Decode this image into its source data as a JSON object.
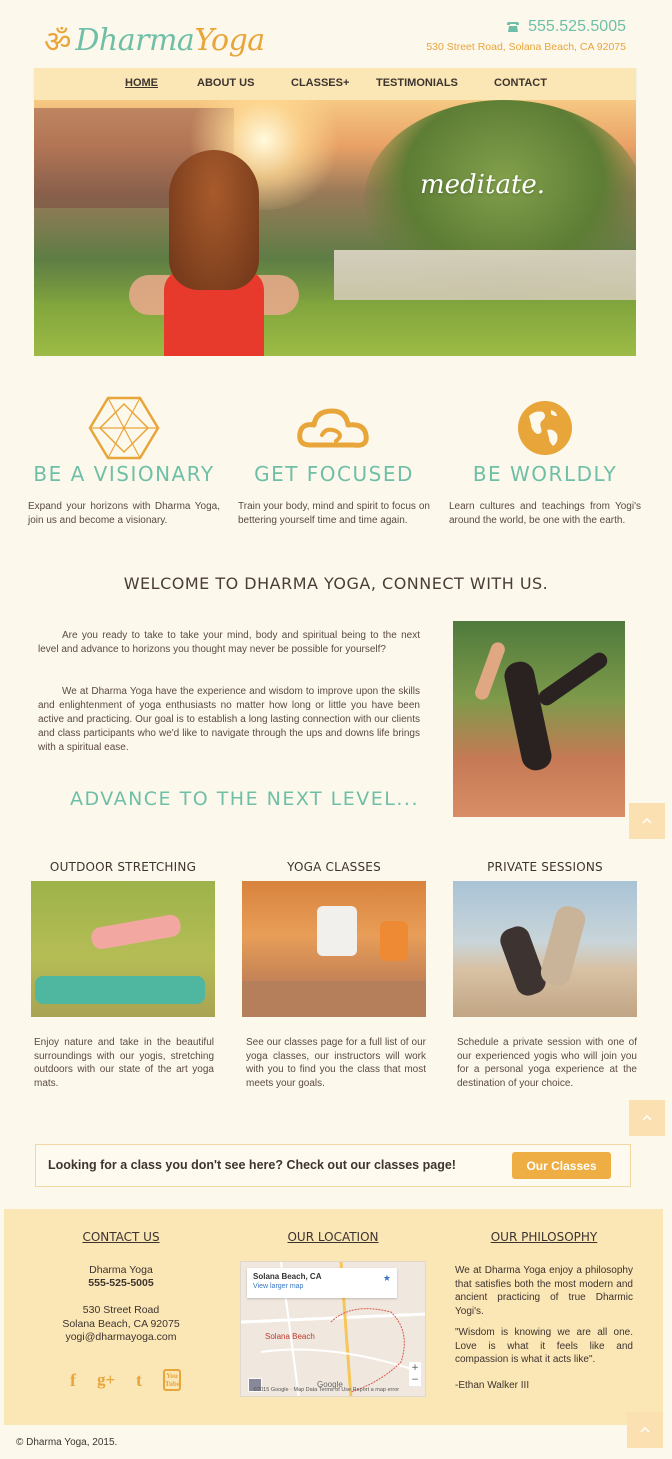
{
  "header": {
    "logo_symbol": "ॐ",
    "logo_word1": "Dharma",
    "logo_word2": "Yoga",
    "phone": "555.525.5005",
    "address": "530 Street Road, Solana Beach, CA 92075"
  },
  "nav": {
    "items": [
      {
        "label": "HOME"
      },
      {
        "label": "ABOUT US"
      },
      {
        "label": "CLASSES"
      },
      {
        "label": "TESTIMONIALS"
      },
      {
        "label": "CONTACT"
      }
    ],
    "classes_expander": "+"
  },
  "hero": {
    "caption": "meditate."
  },
  "features": [
    {
      "title": "BE A VISIONARY",
      "text": "Expand your horizons with Dharma Yoga, join us and become a visionary.",
      "icon": "hexagon-geometric-icon"
    },
    {
      "title": "GET FOCUSED",
      "text": "Train your body, mind and spirit to focus on bettering yourself time and time again.",
      "icon": "cloud-icon"
    },
    {
      "title": "BE WORLDLY",
      "text": "Learn cultures and teachings from Yogi's around the world, be one with the earth.",
      "icon": "globe-icon"
    }
  ],
  "welcome": {
    "title": "WELCOME TO DHARMA YOGA, CONNECT WITH US.",
    "paragraph1": "Are you ready to take to take your mind, body and spiritual being to the next level and advance to horizons you thought may never be possible for yourself?",
    "paragraph2": "We at Dharma Yoga have the experience and wisdom to improve upon the skills and enlightenment of yoga enthusiasts no matter how long or little you have been active and practicing. Our goal is to establish a long lasting connection with our clients and class participants who we'd like to navigate through the ups and downs life brings with a spiritual ease.",
    "advance": "ADVANCE TO THE NEXT LEVEL..."
  },
  "services": [
    {
      "title": "OUTDOOR STRETCHING",
      "text": "Enjoy nature and take in the beautiful surroundings with our yogis, stretching outdoors with our state of the art yoga mats."
    },
    {
      "title": "YOGA CLASSES",
      "text": "See our classes page for a full list of our yoga classes, our instructors will work with you to find you the class that most meets your goals."
    },
    {
      "title": "PRIVATE SESSIONS",
      "text": "Schedule a private session with one of our experienced yogis who will join you for a personal yoga experience at the destination of your choice."
    }
  ],
  "cta": {
    "text": "Looking for a class you don't see here? Check out our classes page!",
    "button": "Our Classes"
  },
  "footer": {
    "contact_heading": "CONTACT US",
    "location_heading": "OUR LOCATION",
    "philosophy_heading": "OUR PHILOSOPHY",
    "contact_name": "Dharma Yoga",
    "contact_phone": "555-525-5005",
    "contact_street": "530 Street Road",
    "contact_city": "Solana Beach, CA 92075",
    "contact_email": "yogi@dharmayoga.com",
    "map_place": "Solana Beach, CA",
    "map_link": "View larger map",
    "map_pin": "Solana Beach",
    "map_google": "Google",
    "map_footer": "©2015 Google · Map Data   Terms of Use   Report a map error",
    "philosophy_p1": "We at Dharma Yoga enjoy a philosophy that satisfies both the most modern and ancient practicing of true Dharmic Yogi's.",
    "philosophy_quote": "\"Wisdom is knowing we are all one. Love is what it feels like and compassion is what it acts like\".",
    "philosophy_author": "-Ethan Walker III",
    "social": [
      {
        "icon": "facebook-icon",
        "glyph": "f"
      },
      {
        "icon": "google-plus-icon",
        "glyph": "g+"
      },
      {
        "icon": "twitter-icon",
        "glyph": "t"
      },
      {
        "icon": "youtube-icon",
        "glyph": "You Tube"
      }
    ]
  },
  "copyright": "© Dharma Yoga, 2015.",
  "colors": {
    "accent_teal": "#6fbfa8",
    "accent_orange": "#e8a53a",
    "nav_bg": "#fbe6b5",
    "page_bg": "#fdf8ec"
  }
}
